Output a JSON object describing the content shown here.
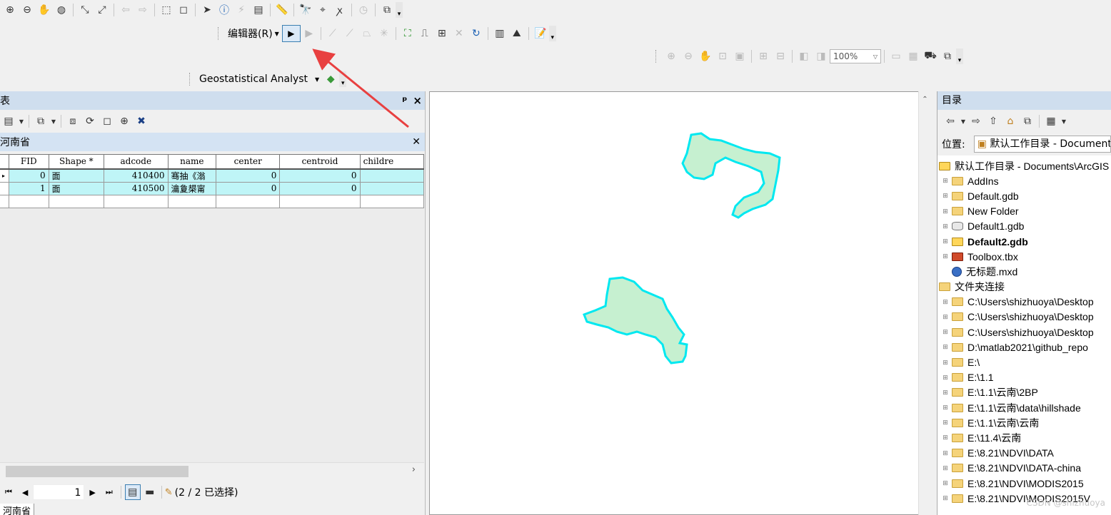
{
  "toolbars": {
    "editor_label": "编辑器(R)",
    "geostat_label": "Geostatistical Analyst",
    "zoom_value": "100%"
  },
  "table_window": {
    "title": "表",
    "pin": "ᵖ",
    "close": "×",
    "tab_name": "河南省",
    "columns": [
      "FID",
      "Shape *",
      "adcode",
      "name",
      "center",
      "centroid",
      "childre"
    ],
    "rows": [
      {
        "fid": "0",
        "shape": "面",
        "adcode": "410400",
        "name": "骞抽《滃",
        "center": "0",
        "centroid": "0"
      },
      {
        "fid": "1",
        "shape": "面",
        "adcode": "410500",
        "name": "瀹夐槼甯",
        "center": "0",
        "centroid": "0"
      }
    ],
    "record_number": "1",
    "selection_status": "(2 / 2 已选择)",
    "bottom_tab": "河南省"
  },
  "catalog": {
    "title": "目录",
    "location_label": "位置:",
    "location_value": "默认工作目录 - Documents\\ArcGIS",
    "items": [
      {
        "label": "默认工作目录 - Documents\\ArcGIS",
        "level": 0,
        "icon": "folder-home-icon"
      },
      {
        "label": "AddIns",
        "level": 1,
        "icon": "folder-icon"
      },
      {
        "label": "Default.gdb",
        "level": 1,
        "icon": "folder-icon"
      },
      {
        "label": "New Folder",
        "level": 1,
        "icon": "folder-icon"
      },
      {
        "label": "Default1.gdb",
        "level": 1,
        "icon": "database-icon"
      },
      {
        "label": "Default2.gdb",
        "level": 1,
        "icon": "geodatabase-icon"
      },
      {
        "label": "Toolbox.tbx",
        "level": 1,
        "icon": "toolbox-icon"
      },
      {
        "label": "无标题.mxd",
        "level": 1,
        "icon": "map-document-icon"
      },
      {
        "label": "文件夹连接",
        "level": 0,
        "icon": "folder-connections-icon"
      },
      {
        "label": "C:\\Users\\shizhuoya\\Desktop",
        "level": 1,
        "icon": "folder-icon"
      },
      {
        "label": "C:\\Users\\shizhuoya\\Desktop",
        "level": 1,
        "icon": "folder-icon"
      },
      {
        "label": "C:\\Users\\shizhuoya\\Desktop",
        "level": 1,
        "icon": "folder-icon"
      },
      {
        "label": "D:\\matlab2021\\github_repo",
        "level": 1,
        "icon": "folder-icon"
      },
      {
        "label": "E:\\",
        "level": 1,
        "icon": "folder-icon"
      },
      {
        "label": "E:\\1.1",
        "level": 1,
        "icon": "folder-icon"
      },
      {
        "label": "E:\\1.1\\云南\\2BP",
        "level": 1,
        "icon": "folder-icon"
      },
      {
        "label": "E:\\1.1\\云南\\data\\hillshade",
        "level": 1,
        "icon": "folder-icon"
      },
      {
        "label": "E:\\1.1\\云南\\云南",
        "level": 1,
        "icon": "folder-icon"
      },
      {
        "label": "E:\\11.4\\云南",
        "level": 1,
        "icon": "folder-icon"
      },
      {
        "label": "E:\\8.21\\NDVI\\DATA",
        "level": 1,
        "icon": "folder-icon"
      },
      {
        "label": "E:\\8.21\\NDVI\\DATA-china",
        "level": 1,
        "icon": "folder-icon"
      },
      {
        "label": "E:\\8.21\\NDVI\\MODIS2015",
        "level": 1,
        "icon": "folder-icon"
      },
      {
        "label": "E:\\8.21\\NDVI\\MODIS2015V",
        "level": 1,
        "icon": "folder-icon"
      }
    ]
  },
  "watermark": "CSDN @shizhuoya",
  "colors": {
    "polygon_fill": "#c6f0d0",
    "polygon_outline": "#00e8f0",
    "selected_row": "#bff5f7",
    "annotation_arrow": "#e84040"
  }
}
